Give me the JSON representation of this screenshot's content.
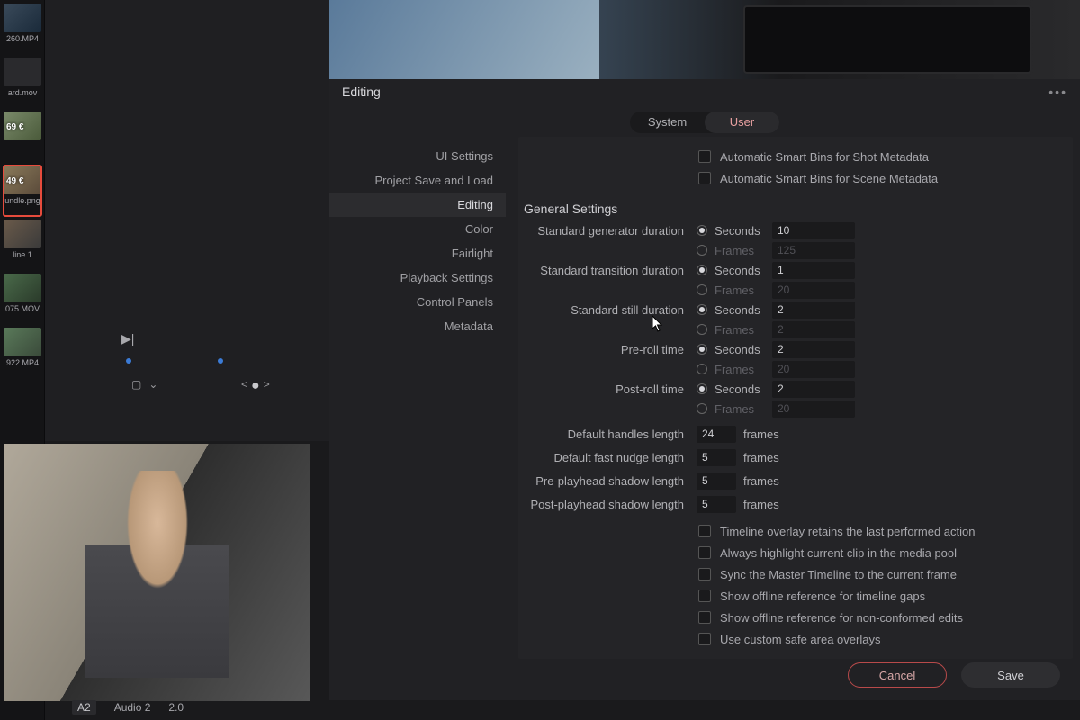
{
  "media_pool": {
    "clips": [
      {
        "label": "260.MP4",
        "price": "",
        "sel": false,
        "bg": "linear-gradient(135deg,#3a4a5a,#1a2a3a)"
      },
      {
        "label": "ard.mov",
        "price": "",
        "sel": false,
        "bg": "#2a2a2d"
      },
      {
        "label": "",
        "price": "69 €",
        "sel": false,
        "bg": "linear-gradient(135deg,#7a8a6a,#4a5a3a)"
      },
      {
        "label": "undle.png",
        "price": "49 €",
        "sel": true,
        "bg": "linear-gradient(135deg,#8a7a5a,#5a4a3a)"
      },
      {
        "label": "line 1",
        "price": "",
        "sel": false,
        "bg": "linear-gradient(135deg,#6a5a4a,#3a3a3a)"
      },
      {
        "label": "075.MOV",
        "price": "",
        "sel": false,
        "bg": "linear-gradient(135deg,#4a6a4a,#2a3a2a)"
      },
      {
        "label": "922.MP4",
        "price": "",
        "sel": false,
        "bg": "linear-gradient(135deg,#5a7a5a,#3a4a3a)"
      }
    ]
  },
  "timeline": {
    "track_id": "A2",
    "track_label": "Audio 2",
    "meter": "2.0"
  },
  "dialog": {
    "title": "Editing",
    "tabs": {
      "system": "System",
      "user": "User"
    },
    "categories": [
      "UI Settings",
      "Project Save and Load",
      "Editing",
      "Color",
      "Fairlight",
      "Playback Settings",
      "Control Panels",
      "Metadata"
    ],
    "active_category": "Editing",
    "smart_bins": {
      "shot": "Automatic Smart Bins for Shot Metadata",
      "scene": "Automatic Smart Bins for Scene Metadata"
    },
    "section": "General Settings",
    "labels": {
      "seconds": "Seconds",
      "frames": "Frames",
      "frames_suffix": "frames"
    },
    "durations": {
      "gen": {
        "label": "Standard generator duration",
        "sec": "10",
        "frm": "125"
      },
      "trans": {
        "label": "Standard transition duration",
        "sec": "1",
        "frm": "20"
      },
      "still": {
        "label": "Standard still duration",
        "sec": "2",
        "frm": "2"
      },
      "pre": {
        "label": "Pre-roll time",
        "sec": "2",
        "frm": "20"
      },
      "post": {
        "label": "Post-roll time",
        "sec": "2",
        "frm": "20"
      }
    },
    "simple_fields": [
      {
        "label": "Default handles length",
        "value": "24"
      },
      {
        "label": "Default fast nudge length",
        "value": "5"
      },
      {
        "label": "Pre-playhead shadow length",
        "value": "5"
      },
      {
        "label": "Post-playhead shadow length",
        "value": "5"
      }
    ],
    "checkboxes2": [
      "Timeline overlay retains the last performed action",
      "Always highlight current clip in the media pool",
      "Sync the Master Timeline to the current frame",
      "Show offline reference for timeline gaps",
      "Show offline reference for non-conformed edits",
      "Use custom safe area overlays"
    ],
    "buttons": {
      "cancel": "Cancel",
      "save": "Save"
    }
  }
}
